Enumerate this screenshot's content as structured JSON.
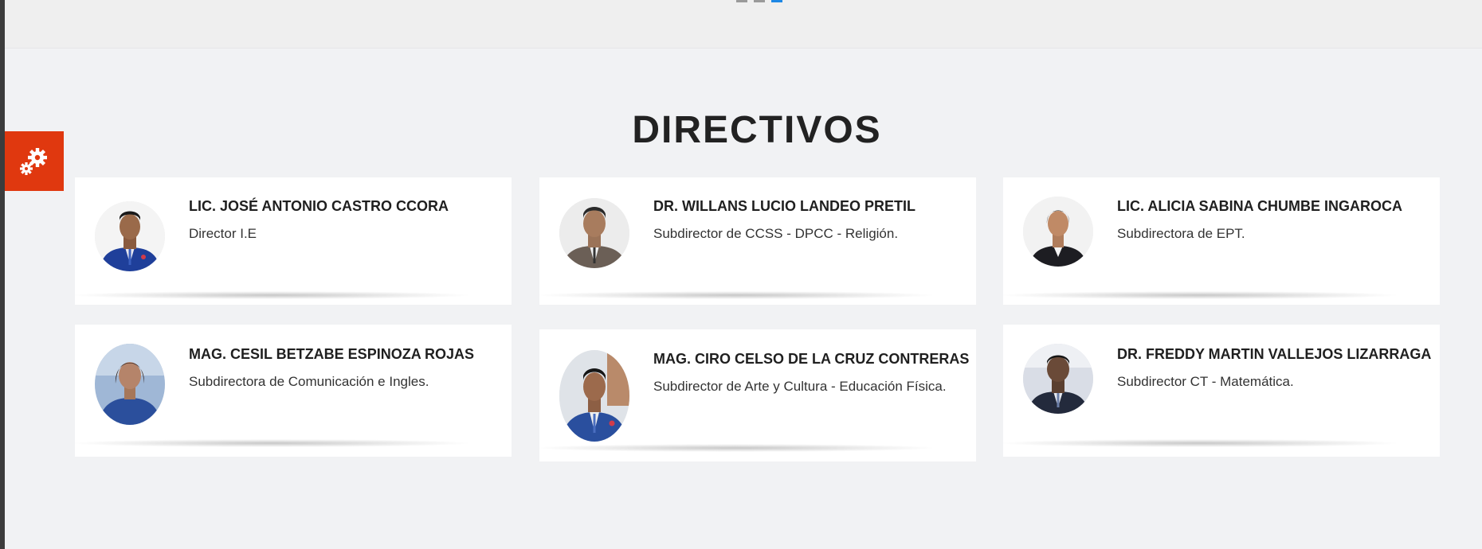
{
  "section": {
    "title": "DIRECTIVOS"
  },
  "colors": {
    "accent": "#e0380f",
    "slider_active": "#1e88e5",
    "card_bg": "#ffffff",
    "page_bg": "#f1f2f4"
  },
  "slider": {
    "dot_count": 3,
    "active_index": 2
  },
  "settings": {
    "icon": "gear-icon"
  },
  "directors": [
    {
      "name": "LIC. JOSÉ ANTONIO CASTRO CCORA",
      "role": "Director I.E",
      "photo": "avatar-man-blue-suit"
    },
    {
      "name": "DR. WILLANS LUCIO LANDEO PRETIL",
      "role": "Subdirector de CCSS - DPCC - Religión.",
      "photo": "avatar-man-grey-suit"
    },
    {
      "name": "LIC. ALICIA SABINA CHUMBE INGAROCA",
      "role": "Subdirectora de EPT.",
      "photo": "avatar-woman-dark-suit"
    },
    {
      "name": "MAG. CESIL BETZABE ESPINOZA ROJAS",
      "role": "Subdirectora de Comunicación e Ingles.",
      "photo": "avatar-woman-blue-jacket"
    },
    {
      "name": "MAG. CIRO CELSO DE LA CRUZ CONTRERAS",
      "role": "Subdirector de Arte y Cultura - Educación Física.",
      "photo": "avatar-man-blue-suit"
    },
    {
      "name": "DR. FREDDY MARTIN VALLEJOS LIZARRAGA",
      "role": "Subdirector CT - Matemática.",
      "photo": "avatar-man-dark-suit"
    }
  ]
}
